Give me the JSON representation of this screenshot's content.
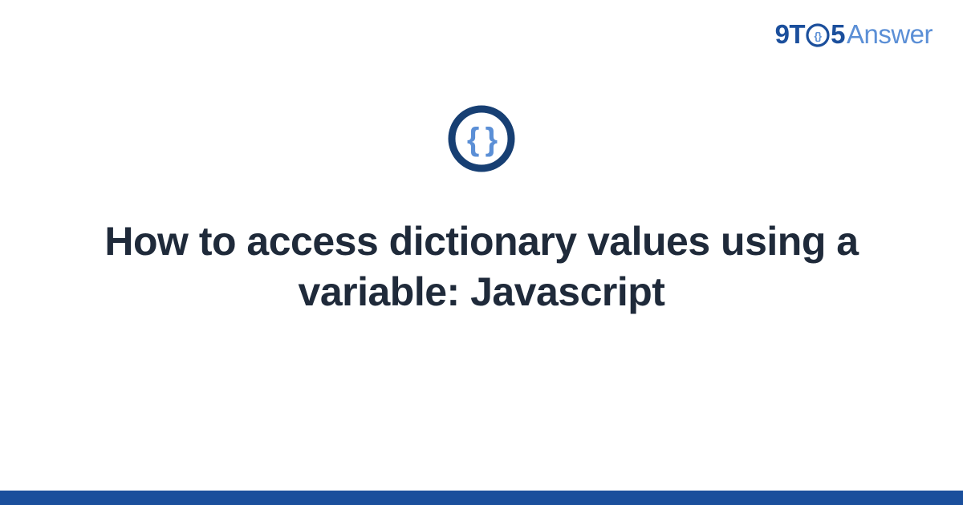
{
  "brand": {
    "part1": "9T",
    "part2": "5",
    "part3": "Answer"
  },
  "category": {
    "icon_name": "code-braces-icon",
    "icon_glyph": "{ }"
  },
  "main": {
    "title": "How to access dictionary values using a variable: Javascript"
  },
  "colors": {
    "brand_primary": "#1b4f9c",
    "brand_secondary": "#5b8fd6",
    "icon_ring": "#173f73",
    "icon_inner": "#5b8fd6",
    "text": "#1f2a3a"
  }
}
